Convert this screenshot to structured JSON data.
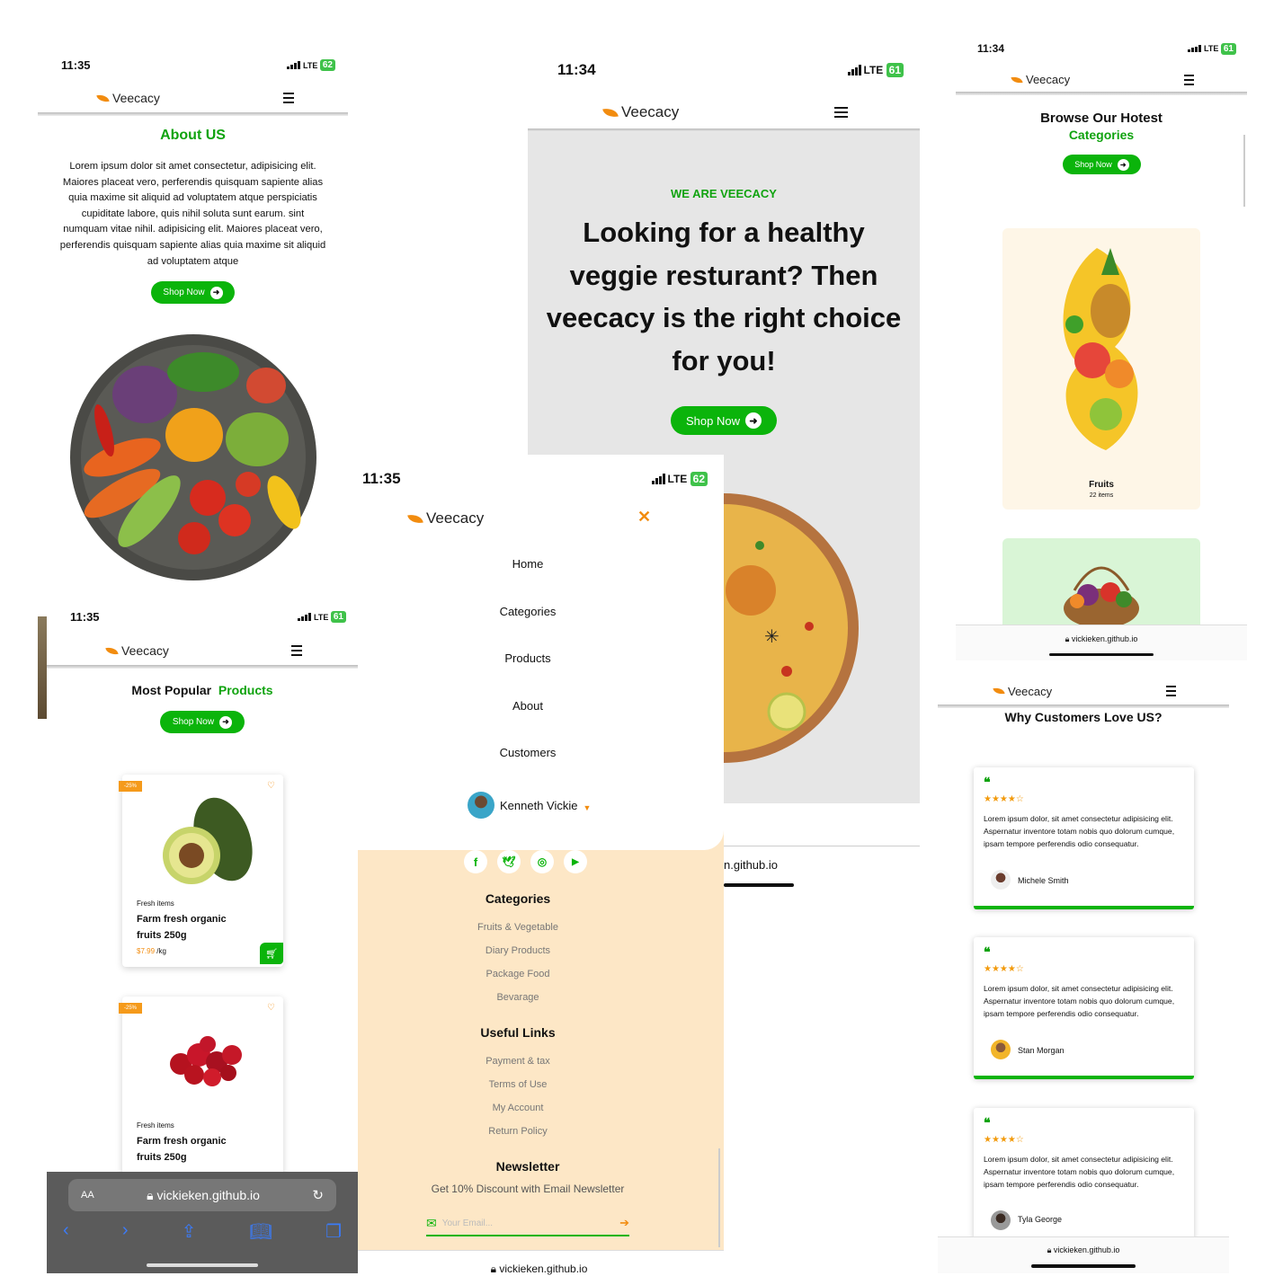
{
  "brand": "Veecacy",
  "about": {
    "time": "11:35",
    "battery": "62",
    "title": "About US",
    "body": "Lorem ipsum dolor sit amet consectetur, adipisicing elit. Maiores placeat vero, perferendis quisquam sapiente alias quia maxime sit aliquid ad voluptatem atque perspiciatis cupiditate labore, quis nihil soluta sunt earum. sint numquam vitae nihil. adipisicing elit. Maiores placeat vero, perferendis quisquam sapiente alias quia maxime sit aliquid ad voluptatem atque",
    "shop_label": "Shop Now"
  },
  "hero": {
    "time": "11:34",
    "battery": "61",
    "eyebrow": "WE ARE VEECACY",
    "headline": "Looking for a healthy veggie resturant? Then veecacy is the right choice for you!",
    "shop_label": "Shop Now",
    "url_fragment": "n.github.io"
  },
  "categories": {
    "time": "11:34",
    "battery": "61",
    "title_line1": "Browse Our Hotest",
    "title_line2": "Categories",
    "shop_label": "Shop Now",
    "card1_name": "Fruits",
    "card1_count": "22 items",
    "url": "vickieken.github.io"
  },
  "menu": {
    "time": "11:35",
    "battery": "62",
    "items": [
      "Home",
      "Categories",
      "Products",
      "About",
      "Customers"
    ],
    "user": "Kenneth Vickie"
  },
  "footer": {
    "categories_title": "Categories",
    "categories": [
      "Fruits & Vegetable",
      "Diary Products",
      "Package Food",
      "Bevarage"
    ],
    "links_title": "Useful Links",
    "links": [
      "Payment & tax",
      "Terms of Use",
      "My Account",
      "Return Policy"
    ],
    "newsletter_title": "Newsletter",
    "newsletter_text": "Get 10% Discount with Email Newsletter",
    "email_placeholder": "Your Email...",
    "url": "vickieken.github.io"
  },
  "products": {
    "time": "11:35",
    "battery": "61",
    "title_a": "Most Popular",
    "title_b": "Products",
    "shop_label": "Shop Now",
    "badge": "-25%",
    "card1": {
      "tag": "Fresh items",
      "name_l1": "Farm fresh organic",
      "name_l2": "fruits 250g",
      "price": "$7.99",
      "unit": "/kg"
    },
    "card2": {
      "tag": "Fresh items",
      "name_l1": "Farm fresh organic",
      "name_l2": "fruits 250g"
    },
    "safari_text_size": "AA",
    "safari_url": "vickieken.github.io"
  },
  "reviews": {
    "title": "Why Customers Love US?",
    "text": "Lorem ipsum dolor, sit amet consectetur adipisicing elit. Aspernatur inventore totam nobis quo dolorum cumque, ipsam tempore perferendis odio consequatur.",
    "names": [
      "Michele Smith",
      "Stan Morgan",
      "Tyla George"
    ],
    "stars": "★★★★☆",
    "rating": 4,
    "url": "vickieken.github.io"
  },
  "colors": {
    "accent": "#0bb40b",
    "brand_orange": "#f28c0f",
    "footer_bg": "#fde7c6"
  }
}
